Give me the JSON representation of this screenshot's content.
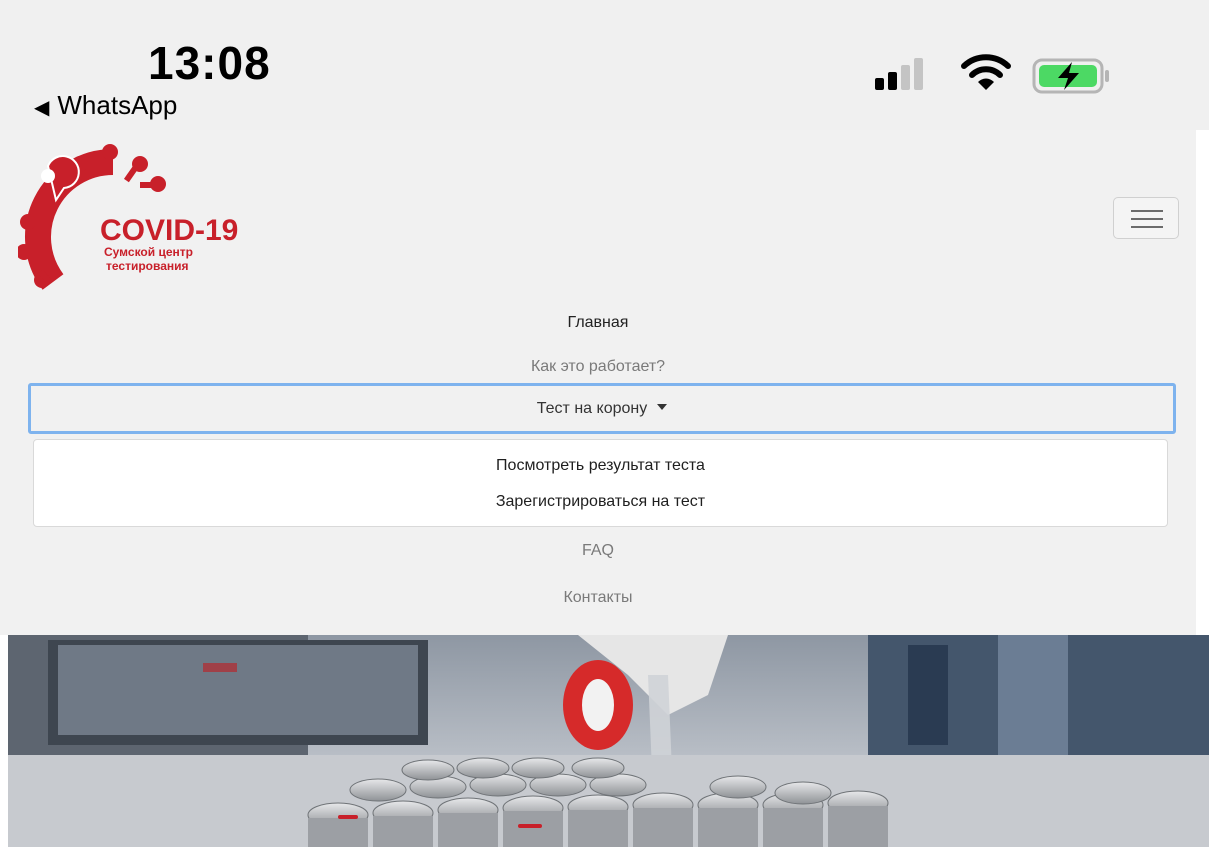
{
  "status_bar": {
    "time": "13:08",
    "back_app": "WhatsApp",
    "icons": [
      "cellular-signal-icon",
      "wifi-icon",
      "battery-charging-icon"
    ]
  },
  "logo": {
    "title": "COVID-19",
    "subtitle_line1": "Сумской центр",
    "subtitle_line2": "тестирования"
  },
  "nav": {
    "items": [
      {
        "label": "Главная"
      },
      {
        "label": "Как это работает?"
      },
      {
        "label": "Тест на корону"
      },
      {
        "label": "FAQ"
      },
      {
        "label": "Контакты"
      }
    ],
    "dropdown": [
      {
        "label": "Посмотреть результат теста"
      },
      {
        "label": "Зарегистрироваться на тест"
      }
    ]
  },
  "colors": {
    "brand_red": "#c8202a",
    "focus_ring": "#7eb3ee",
    "battery_green": "#4cd964"
  }
}
